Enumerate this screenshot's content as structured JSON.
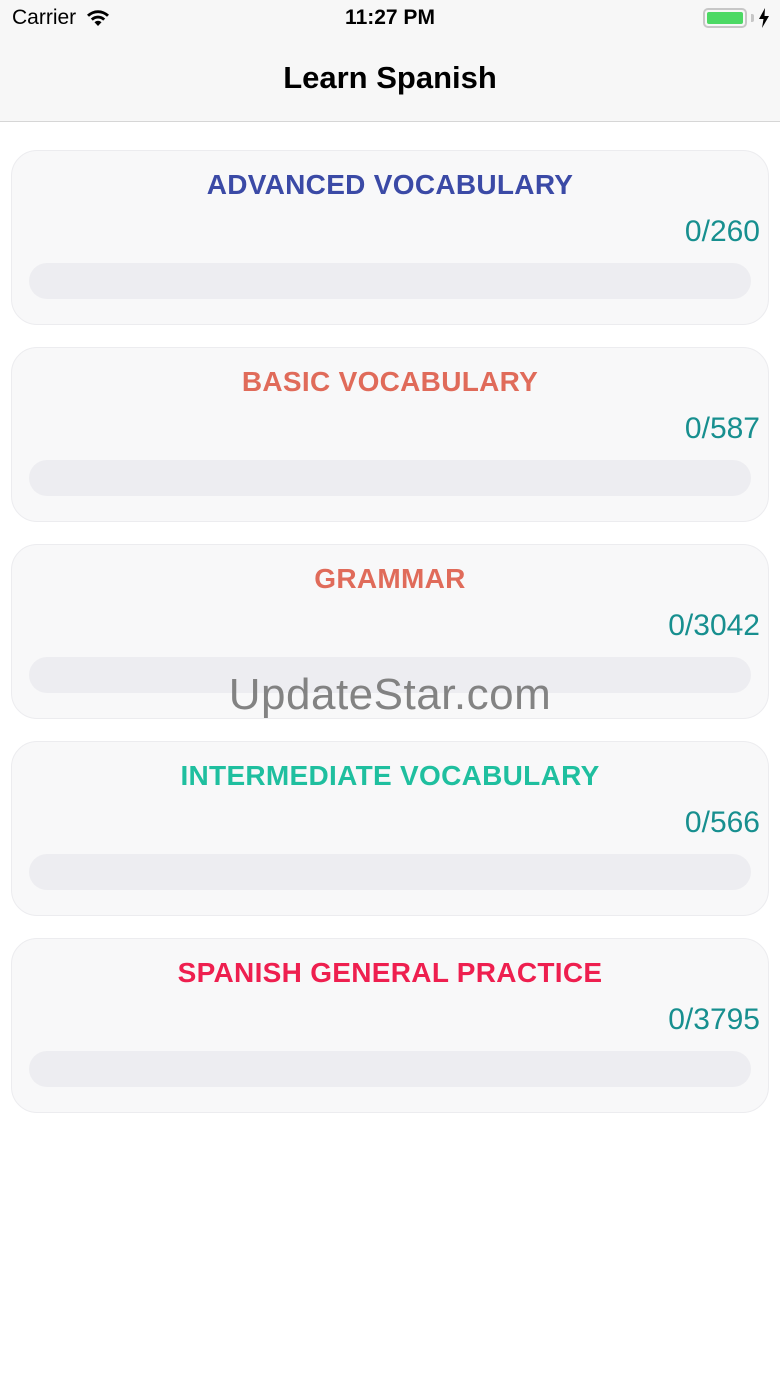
{
  "status_bar": {
    "carrier": "Carrier",
    "time": "11:27 PM",
    "icons": [
      "wifi-icon",
      "battery-icon",
      "charging-bolt-icon"
    ]
  },
  "nav": {
    "title": "Learn Spanish"
  },
  "categories": [
    {
      "title": "ADVANCED VOCABULARY",
      "count": "0/260",
      "progress": 0,
      "color": "#3b4aa6"
    },
    {
      "title": "BASIC VOCABULARY",
      "count": "0/587",
      "progress": 0,
      "color": "#e06b5a"
    },
    {
      "title": "GRAMMAR",
      "count": "0/3042",
      "progress": 0,
      "color": "#e06b5a"
    },
    {
      "title": "INTERMEDIATE VOCABULARY",
      "count": "0/566",
      "progress": 0,
      "color": "#1fbf9f"
    },
    {
      "title": "SPANISH GENERAL PRACTICE",
      "count": "0/3795",
      "progress": 0,
      "color": "#ee1f4f"
    }
  ],
  "count_color": "#178f8f",
  "watermark": "UpdateStar.com"
}
